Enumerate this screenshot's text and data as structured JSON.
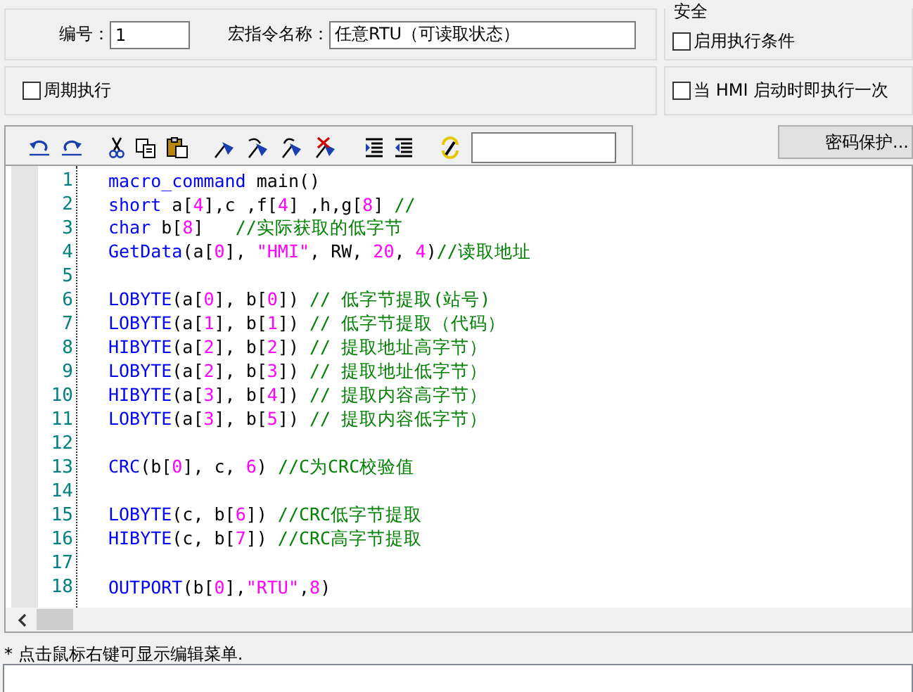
{
  "header": {
    "number_label": "编号：",
    "number_value": "1",
    "name_label": "宏指令名称：",
    "name_value": "任意RTU（可读取状态）"
  },
  "security": {
    "title": "安全",
    "enable_condition": {
      "label": "启用执行条件",
      "checked": false
    }
  },
  "periodic": {
    "label": "周期执行",
    "checked": false
  },
  "run_on_start": {
    "label": "当 HMI 启动时即执行一次",
    "checked": false
  },
  "password_button": "密码保护...",
  "code_lines": [
    {
      "no": "1",
      "tokens": [
        {
          "kind": "kw",
          "text": "macro_command"
        },
        {
          "kind": "plain",
          "text": " main()"
        }
      ]
    },
    {
      "no": "2",
      "tokens": [
        {
          "kind": "kw",
          "text": "short"
        },
        {
          "kind": "plain",
          "text": " a["
        },
        {
          "kind": "num",
          "text": "4"
        },
        {
          "kind": "plain",
          "text": "],c ,f["
        },
        {
          "kind": "num",
          "text": "4"
        },
        {
          "kind": "plain",
          "text": "] ,h,g["
        },
        {
          "kind": "num",
          "text": "8"
        },
        {
          "kind": "plain",
          "text": "] "
        },
        {
          "kind": "cm",
          "text": "//"
        }
      ]
    },
    {
      "no": "3",
      "tokens": [
        {
          "kind": "kw",
          "text": "char"
        },
        {
          "kind": "plain",
          "text": " b["
        },
        {
          "kind": "num",
          "text": "8"
        },
        {
          "kind": "plain",
          "text": "]   "
        },
        {
          "kind": "cm",
          "text": "//实际获取的低字节"
        }
      ]
    },
    {
      "no": "4",
      "tokens": [
        {
          "kind": "kw",
          "text": "GetData"
        },
        {
          "kind": "plain",
          "text": "(a["
        },
        {
          "kind": "num",
          "text": "0"
        },
        {
          "kind": "plain",
          "text": "], "
        },
        {
          "kind": "str",
          "text": "\"HMI\""
        },
        {
          "kind": "plain",
          "text": ", RW, "
        },
        {
          "kind": "num",
          "text": "20"
        },
        {
          "kind": "plain",
          "text": ", "
        },
        {
          "kind": "num",
          "text": "4"
        },
        {
          "kind": "plain",
          "text": ")"
        },
        {
          "kind": "cm",
          "text": "//读取地址"
        }
      ]
    },
    {
      "no": "5"
    },
    {
      "no": "6",
      "tokens": [
        {
          "kind": "kw",
          "text": "LOBYTE"
        },
        {
          "kind": "plain",
          "text": "(a["
        },
        {
          "kind": "num",
          "text": "0"
        },
        {
          "kind": "plain",
          "text": "], b["
        },
        {
          "kind": "num",
          "text": "0"
        },
        {
          "kind": "plain",
          "text": "]) "
        },
        {
          "kind": "cm",
          "text": "// 低字节提取(站号)"
        }
      ]
    },
    {
      "no": "7",
      "tokens": [
        {
          "kind": "kw",
          "text": "LOBYTE"
        },
        {
          "kind": "plain",
          "text": "(a["
        },
        {
          "kind": "num",
          "text": "1"
        },
        {
          "kind": "plain",
          "text": "], b["
        },
        {
          "kind": "num",
          "text": "1"
        },
        {
          "kind": "plain",
          "text": "]) "
        },
        {
          "kind": "cm",
          "text": "// 低字节提取（代码）"
        }
      ]
    },
    {
      "no": "8",
      "tokens": [
        {
          "kind": "kw",
          "text": "HIBYTE"
        },
        {
          "kind": "plain",
          "text": "(a["
        },
        {
          "kind": "num",
          "text": "2"
        },
        {
          "kind": "plain",
          "text": "], b["
        },
        {
          "kind": "num",
          "text": "2"
        },
        {
          "kind": "plain",
          "text": "]) "
        },
        {
          "kind": "cm",
          "text": "// 提取地址高字节）"
        }
      ]
    },
    {
      "no": "9",
      "tokens": [
        {
          "kind": "kw",
          "text": "LOBYTE"
        },
        {
          "kind": "plain",
          "text": "(a["
        },
        {
          "kind": "num",
          "text": "2"
        },
        {
          "kind": "plain",
          "text": "], b["
        },
        {
          "kind": "num",
          "text": "3"
        },
        {
          "kind": "plain",
          "text": "]) "
        },
        {
          "kind": "cm",
          "text": "// 提取地址低字节）"
        }
      ]
    },
    {
      "no": "10",
      "tokens": [
        {
          "kind": "kw",
          "text": "HIBYTE"
        },
        {
          "kind": "plain",
          "text": "(a["
        },
        {
          "kind": "num",
          "text": "3"
        },
        {
          "kind": "plain",
          "text": "], b["
        },
        {
          "kind": "num",
          "text": "4"
        },
        {
          "kind": "plain",
          "text": "]) "
        },
        {
          "kind": "cm",
          "text": "// 提取内容高字节）"
        }
      ]
    },
    {
      "no": "11",
      "tokens": [
        {
          "kind": "kw",
          "text": "LOBYTE"
        },
        {
          "kind": "plain",
          "text": "(a["
        },
        {
          "kind": "num",
          "text": "3"
        },
        {
          "kind": "plain",
          "text": "], b["
        },
        {
          "kind": "num",
          "text": "5"
        },
        {
          "kind": "plain",
          "text": "]) "
        },
        {
          "kind": "cm",
          "text": "// 提取内容低字节）"
        }
      ]
    },
    {
      "no": "12"
    },
    {
      "no": "13",
      "tokens": [
        {
          "kind": "kw",
          "text": "CRC"
        },
        {
          "kind": "plain",
          "text": "(b["
        },
        {
          "kind": "num",
          "text": "0"
        },
        {
          "kind": "plain",
          "text": "], c, "
        },
        {
          "kind": "num",
          "text": "6"
        },
        {
          "kind": "plain",
          "text": ") "
        },
        {
          "kind": "cm",
          "text": "//C为CRC校验值"
        }
      ]
    },
    {
      "no": "14"
    },
    {
      "no": "15",
      "tokens": [
        {
          "kind": "kw",
          "text": "LOBYTE"
        },
        {
          "kind": "plain",
          "text": "(c, b["
        },
        {
          "kind": "num",
          "text": "6"
        },
        {
          "kind": "plain",
          "text": "]) "
        },
        {
          "kind": "cm",
          "text": "//CRC低字节提取"
        }
      ]
    },
    {
      "no": "16",
      "tokens": [
        {
          "kind": "kw",
          "text": "HIBYTE"
        },
        {
          "kind": "plain",
          "text": "(c, b["
        },
        {
          "kind": "num",
          "text": "7"
        },
        {
          "kind": "plain",
          "text": "]) "
        },
        {
          "kind": "cm",
          "text": "//CRC高字节提取"
        }
      ]
    },
    {
      "no": "17"
    },
    {
      "no": "18",
      "tokens": [
        {
          "kind": "kw",
          "text": "OUTPORT"
        },
        {
          "kind": "plain",
          "text": "(b["
        },
        {
          "kind": "num",
          "text": "0"
        },
        {
          "kind": "plain",
          "text": "],"
        },
        {
          "kind": "str",
          "text": "\"RTU\""
        },
        {
          "kind": "plain",
          "text": ","
        },
        {
          "kind": "num",
          "text": "8"
        },
        {
          "kind": "plain",
          "text": ")"
        }
      ]
    }
  ],
  "status_hint": "* 点击鼠标右键可显示编辑菜单."
}
